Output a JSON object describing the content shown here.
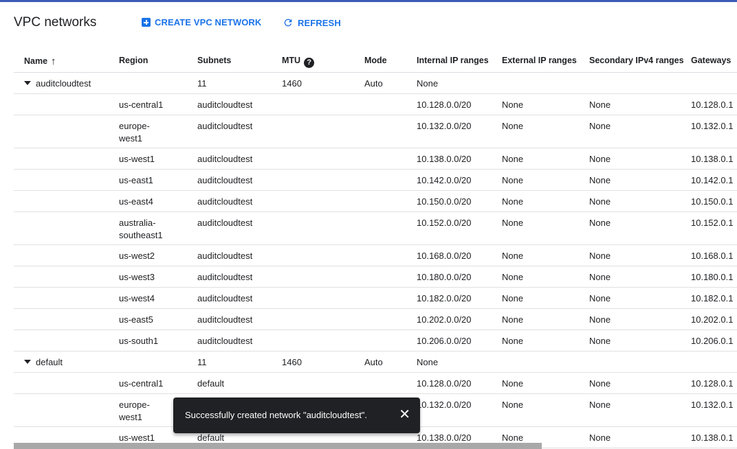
{
  "header": {
    "title": "VPC networks",
    "create_label": "CREATE VPC NETWORK",
    "refresh_label": "REFRESH",
    "create_icon": "add-box-icon",
    "refresh_icon": "refresh-icon"
  },
  "table": {
    "columns": {
      "name": "Name",
      "region": "Region",
      "subnets": "Subnets",
      "mtu": "MTU",
      "mode": "Mode",
      "internal": "Internal IP ranges",
      "external": "External IP ranges",
      "secondary": "Secondary IPv4 ranges",
      "gateways": "Gateways"
    },
    "sort_icon": "↑",
    "help_icon": "?",
    "networks": [
      {
        "name": "auditcloudtest",
        "subnets_count": "11",
        "mtu": "1460",
        "mode": "Auto",
        "internal": "None",
        "subnets": [
          {
            "region": "us-central1",
            "subnet": "auditcloudtest",
            "internal": "10.128.0.0/20",
            "external": "None",
            "secondary": "None",
            "gateway": "10.128.0.1"
          },
          {
            "region": "europe-west1",
            "subnet": "auditcloudtest",
            "internal": "10.132.0.0/20",
            "external": "None",
            "secondary": "None",
            "gateway": "10.132.0.1"
          },
          {
            "region": "us-west1",
            "subnet": "auditcloudtest",
            "internal": "10.138.0.0/20",
            "external": "None",
            "secondary": "None",
            "gateway": "10.138.0.1"
          },
          {
            "region": "us-east1",
            "subnet": "auditcloudtest",
            "internal": "10.142.0.0/20",
            "external": "None",
            "secondary": "None",
            "gateway": "10.142.0.1"
          },
          {
            "region": "us-east4",
            "subnet": "auditcloudtest",
            "internal": "10.150.0.0/20",
            "external": "None",
            "secondary": "None",
            "gateway": "10.150.0.1"
          },
          {
            "region": "australia-southeast1",
            "subnet": "auditcloudtest",
            "internal": "10.152.0.0/20",
            "external": "None",
            "secondary": "None",
            "gateway": "10.152.0.1"
          },
          {
            "region": "us-west2",
            "subnet": "auditcloudtest",
            "internal": "10.168.0.0/20",
            "external": "None",
            "secondary": "None",
            "gateway": "10.168.0.1"
          },
          {
            "region": "us-west3",
            "subnet": "auditcloudtest",
            "internal": "10.180.0.0/20",
            "external": "None",
            "secondary": "None",
            "gateway": "10.180.0.1"
          },
          {
            "region": "us-west4",
            "subnet": "auditcloudtest",
            "internal": "10.182.0.0/20",
            "external": "None",
            "secondary": "None",
            "gateway": "10.182.0.1"
          },
          {
            "region": "us-east5",
            "subnet": "auditcloudtest",
            "internal": "10.202.0.0/20",
            "external": "None",
            "secondary": "None",
            "gateway": "10.202.0.1"
          },
          {
            "region": "us-south1",
            "subnet": "auditcloudtest",
            "internal": "10.206.0.0/20",
            "external": "None",
            "secondary": "None",
            "gateway": "10.206.0.1"
          }
        ]
      },
      {
        "name": "default",
        "subnets_count": "11",
        "mtu": "1460",
        "mode": "Auto",
        "internal": "None",
        "subnets": [
          {
            "region": "us-central1",
            "subnet": "default",
            "internal": "10.128.0.0/20",
            "external": "None",
            "secondary": "None",
            "gateway": "10.128.0.1"
          },
          {
            "region": "europe-west1",
            "subnet": "default",
            "internal": "10.132.0.0/20",
            "external": "None",
            "secondary": "None",
            "gateway": "10.132.0.1"
          },
          {
            "region": "us-west1",
            "subnet": "default",
            "internal": "10.138.0.0/20",
            "external": "None",
            "secondary": "None",
            "gateway": "10.138.0.1"
          }
        ]
      }
    ]
  },
  "toast": {
    "message": "Successfully created network \"auditcloudtest\".",
    "close_icon": "✕"
  }
}
